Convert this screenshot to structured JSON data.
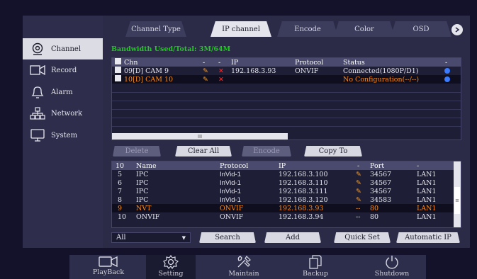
{
  "sidebar": {
    "items": [
      {
        "label": "Channel",
        "icon": "camera-lens-icon",
        "active": true
      },
      {
        "label": "Record",
        "icon": "video-camera-icon"
      },
      {
        "label": "Alarm",
        "icon": "bell-icon"
      },
      {
        "label": "Network",
        "icon": "network-icon"
      },
      {
        "label": "System",
        "icon": "monitor-icon"
      }
    ]
  },
  "tabs": [
    "Channel Type",
    "IP channel",
    "Encode",
    "Color",
    "OSD"
  ],
  "bandwidth": "Bandwidth Used/Total: 3M/64M",
  "channel_table": {
    "headers": [
      "Chn",
      "-",
      "-",
      "IP",
      "Protocol",
      "Status",
      "-"
    ],
    "rows": [
      {
        "chn": "09[D] CAM 9",
        "ip": "192.168.3.93",
        "protocol": "ONVIF",
        "status": "Connected(1080P/D1)"
      },
      {
        "chn": "10[D] CAM 10",
        "ip": "",
        "protocol": "",
        "status": "No Configuration(--/--)"
      }
    ],
    "scroll_glyph": "III"
  },
  "buttons": {
    "delete": "Delete",
    "clear_all": "Clear All",
    "encode": "Encode",
    "copy_to": "Copy To",
    "search": "Search",
    "add": "Add",
    "quick_set": "Quick Set",
    "automatic_ip": "Automatic IP"
  },
  "device_table": {
    "headers": [
      "10",
      "Name",
      "Protocol",
      "IP",
      "-",
      "Port",
      "-"
    ],
    "rows": [
      {
        "no": "5",
        "name": "IPC",
        "protocol": "InVid-1",
        "ip": "192.168.3.100",
        "edit": "✎",
        "port": "34567",
        "net": "LAN1"
      },
      {
        "no": "6",
        "name": "IPC",
        "protocol": "InVid-1",
        "ip": "192.168.3.110",
        "edit": "✎",
        "port": "34567",
        "net": "LAN1"
      },
      {
        "no": "7",
        "name": "IPC",
        "protocol": "InVid-1",
        "ip": "192.168.3.111",
        "edit": "✎",
        "port": "34567",
        "net": "LAN1"
      },
      {
        "no": "8",
        "name": "IPC",
        "protocol": "InVid-1",
        "ip": "192.168.3.120",
        "edit": "✎",
        "port": "34583",
        "net": "LAN1"
      },
      {
        "no": "9",
        "name": "NVT",
        "protocol": "ONVIF",
        "ip": "192.168.3.93",
        "edit": "--",
        "port": "80",
        "net": "LAN1"
      },
      {
        "no": "10",
        "name": "ONVIF",
        "protocol": "ONVIF",
        "ip": "192.168.3.94",
        "edit": "--",
        "port": "80",
        "net": "LAN1"
      }
    ]
  },
  "filter": {
    "value": "All"
  },
  "dock": {
    "items": [
      {
        "label": "PlayBack",
        "icon": "playback-icon"
      },
      {
        "label": "Setting",
        "icon": "gear-icon",
        "active": true
      },
      {
        "label": "Maintain",
        "icon": "tools-icon"
      },
      {
        "label": "Backup",
        "icon": "backup-icon"
      },
      {
        "label": "Shutdown",
        "icon": "power-icon"
      }
    ]
  },
  "colors": {
    "accent_green": "#1ecb1e",
    "highlight_orange": "#ff8c1a",
    "bg": "#13122a",
    "panel": "#2b2b48"
  }
}
